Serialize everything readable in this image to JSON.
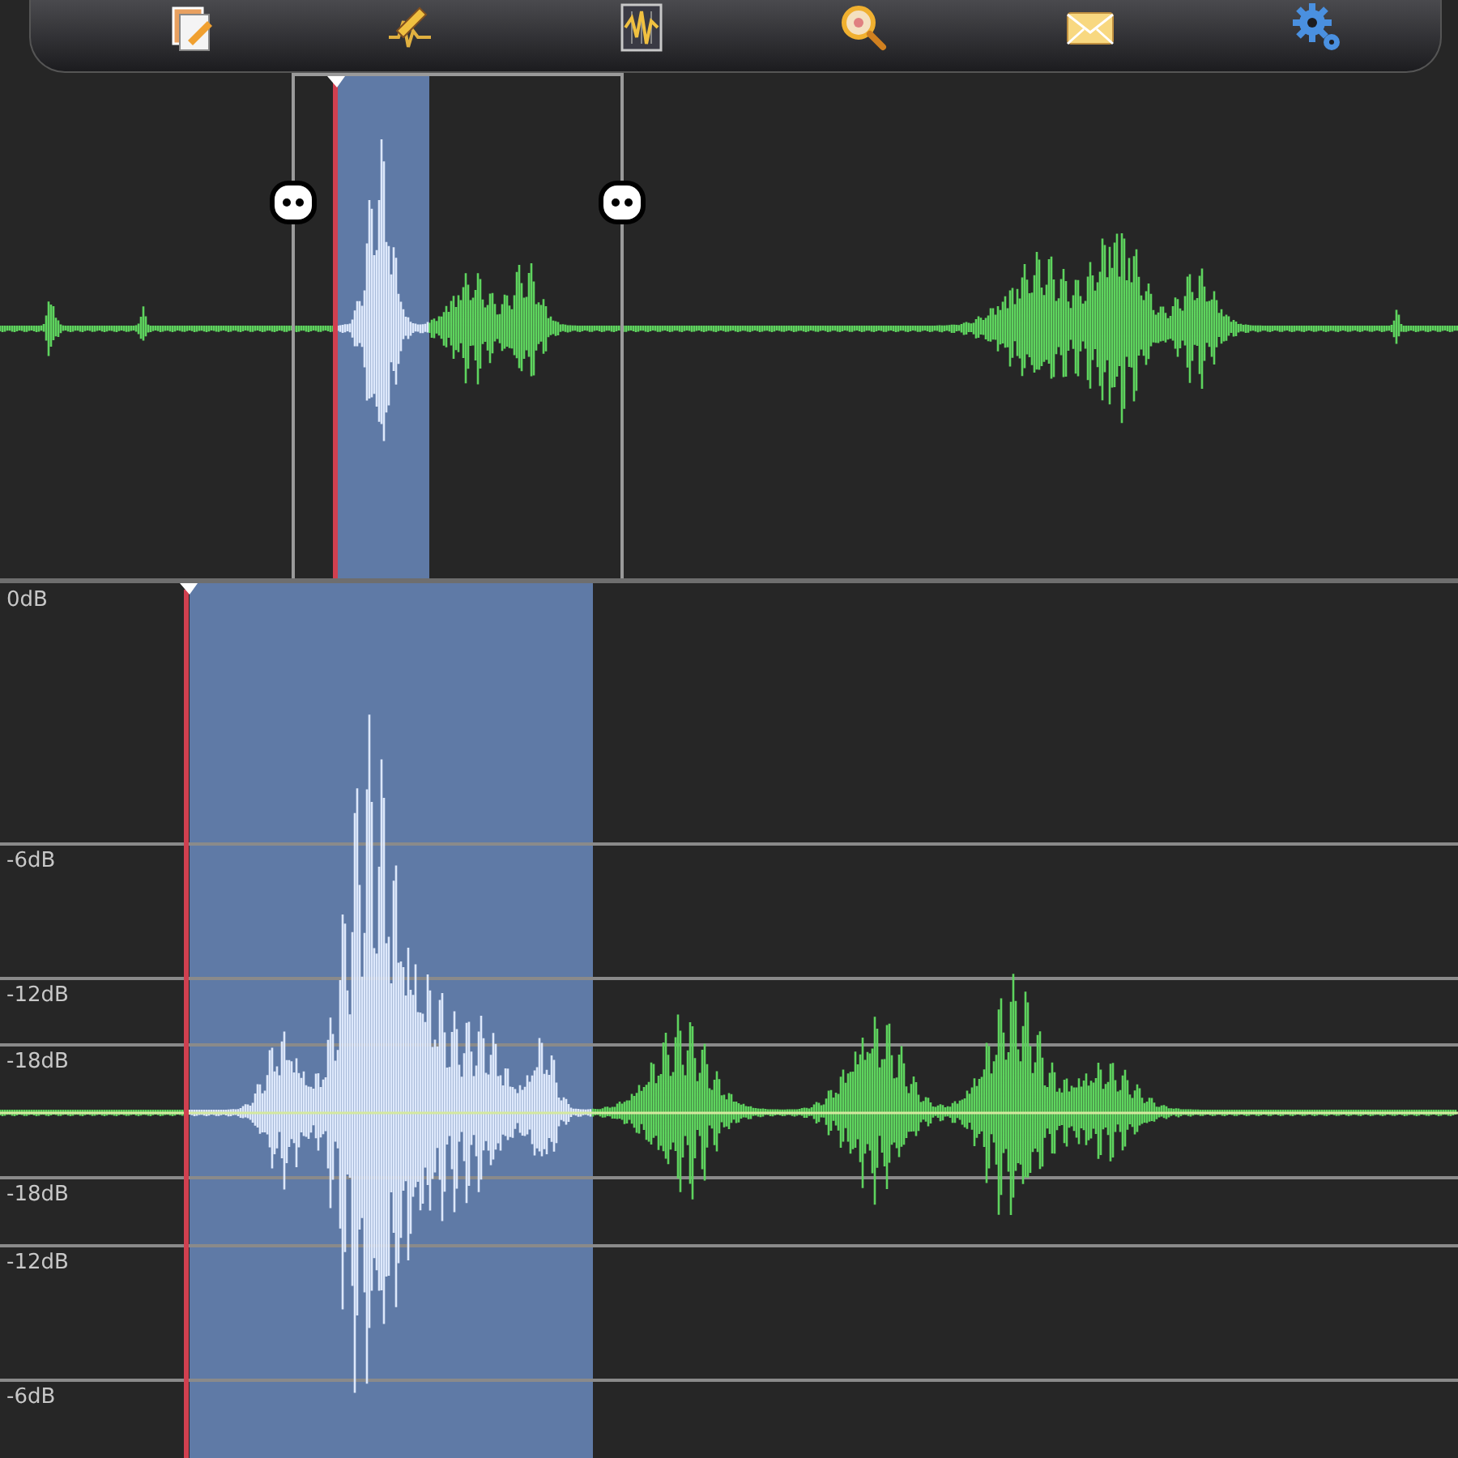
{
  "db_scale": [
    {
      "label": "0dB",
      "kind": "top"
    },
    {
      "label": "-6dB",
      "kind": "upper"
    },
    {
      "label": "-12dB",
      "kind": "upper"
    },
    {
      "label": "-18dB",
      "kind": "upper"
    },
    {
      "label": "-18dB",
      "kind": "lower"
    },
    {
      "label": "-12dB",
      "kind": "lower"
    },
    {
      "label": "-6dB",
      "kind": "lower"
    }
  ]
}
